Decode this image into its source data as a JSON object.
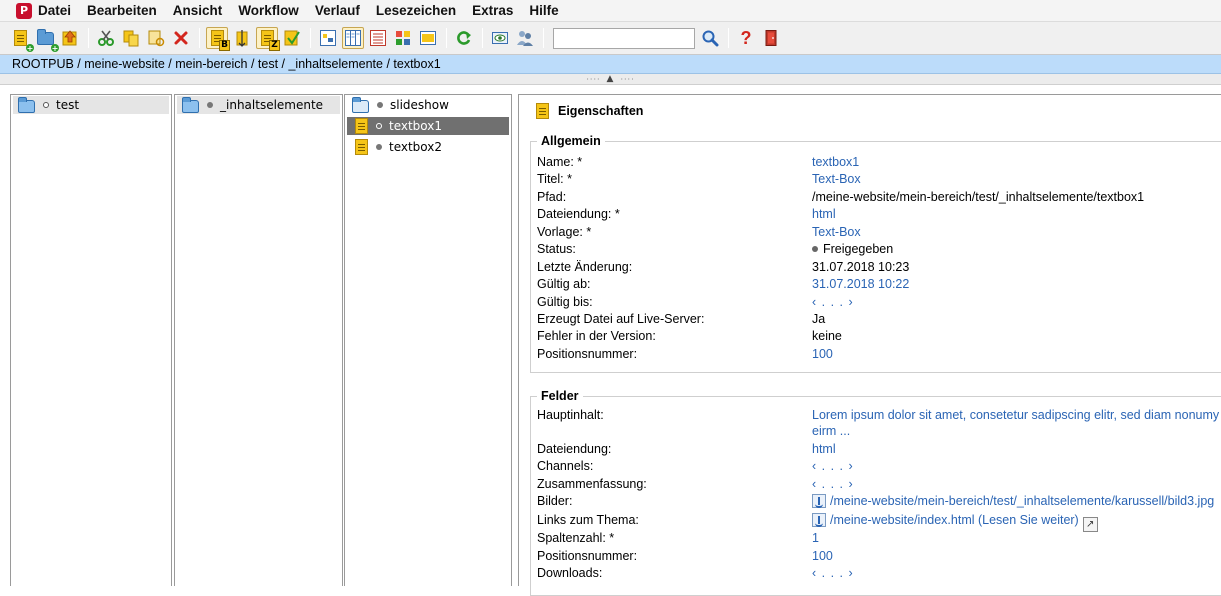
{
  "menubar": {
    "logo_letter": "P",
    "items": [
      "Datei",
      "Bearbeiten",
      "Ansicht",
      "Workflow",
      "Verlauf",
      "Lesezeichen",
      "Extras",
      "Hilfe"
    ]
  },
  "toolbar": {
    "sort_b": "B",
    "sort_z": "Z",
    "search_value": "",
    "help_glyph": "?"
  },
  "breadcrumb": "ROOTPUB / meine-website / mein-bereich / test / _inhaltselemente / textbox1",
  "columns": [
    {
      "items": [
        {
          "label": "test",
          "selected": true
        }
      ]
    },
    {
      "items": [
        {
          "label": "_inhaltselemente",
          "selected": true
        }
      ]
    },
    {
      "items": [
        {
          "label": "slideshow"
        },
        {
          "label": "textbox1",
          "selected": true
        },
        {
          "label": "textbox2"
        }
      ]
    }
  ],
  "properties": {
    "title": "Eigenschaften",
    "general": {
      "legend": "Allgemein",
      "rows": [
        {
          "label": "Name: *",
          "value": "textbox1"
        },
        {
          "label": "Titel: *",
          "value": "Text-Box"
        },
        {
          "label": "Pfad:",
          "value": "/meine-website/mein-bereich/test/_inhaltselemente/textbox1"
        },
        {
          "label": "Dateiendung: *",
          "value": "html"
        },
        {
          "label": "Vorlage: *",
          "value": "Text-Box"
        },
        {
          "label": "Status:",
          "value": "Freigegeben"
        },
        {
          "label": "Letzte Änderung:",
          "value": "31.07.2018 10:23"
        },
        {
          "label": "Gültig ab:",
          "value": "31.07.2018 10:22"
        },
        {
          "label": "Gültig bis:",
          "value": "‹ . . . ›"
        },
        {
          "label": "Erzeugt Datei auf Live-Server:",
          "value": "Ja"
        },
        {
          "label": "Fehler in der Version:",
          "value": "keine"
        },
        {
          "label": "Positionsnummer:",
          "value": "100"
        }
      ]
    },
    "fields": {
      "legend": "Felder",
      "rows": [
        {
          "label": "Hauptinhalt:",
          "value": "Lorem ipsum dolor sit amet, consetetur sadipscing elitr, sed diam nonumy",
          "value2": "eirm ..."
        },
        {
          "label": "Dateiendung:",
          "value": "html"
        },
        {
          "label": "Channels:",
          "value": "‹ . . . ›"
        },
        {
          "label": "Zusammenfassung:",
          "value": "‹ . . . ›"
        },
        {
          "label": "Bilder:",
          "value": "/meine-website/mein-bereich/test/_inhaltselemente/karussell/bild3.jpg"
        },
        {
          "label": "Links zum Thema:",
          "value": "/meine-website/index.html (Lesen Sie weiter)"
        },
        {
          "label": "Spaltenzahl: *",
          "value": "1"
        },
        {
          "label": "Positionsnummer:",
          "value": "100"
        },
        {
          "label": "Downloads:",
          "value": "‹ . . . ›"
        }
      ]
    }
  }
}
